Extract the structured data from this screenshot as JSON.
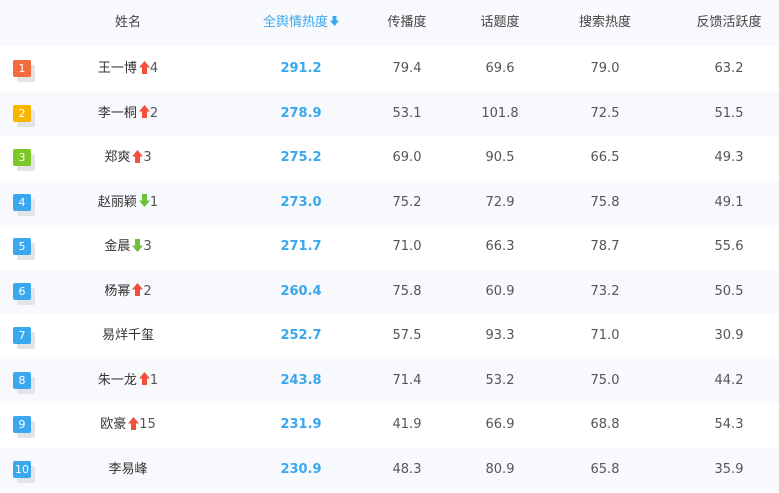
{
  "colors": {
    "accent": "#3aa8ee",
    "up": "#f0503c",
    "down": "#6cc03c",
    "rank_1": "#f26a3d",
    "rank_2": "#f8b600",
    "rank_3": "#7dc726",
    "rank_other": "#3aa8ee"
  },
  "columns": {
    "name": "姓名",
    "total": "全舆情热度",
    "spread": "传播度",
    "topic": "话题度",
    "search": "搜索热度",
    "feedback": "反馈活跃度"
  },
  "sort_icon": "arrow-down-icon",
  "rows": [
    {
      "rank": "1",
      "name": "王一博",
      "trend": "up",
      "trend_value": "4",
      "total": "291.2",
      "spread": "79.4",
      "topic": "69.6",
      "search": "79.0",
      "feedback": "63.2"
    },
    {
      "rank": "2",
      "name": "李一桐",
      "trend": "up",
      "trend_value": "2",
      "total": "278.9",
      "spread": "53.1",
      "topic": "101.8",
      "search": "72.5",
      "feedback": "51.5"
    },
    {
      "rank": "3",
      "name": "郑爽",
      "trend": "up",
      "trend_value": "3",
      "total": "275.2",
      "spread": "69.0",
      "topic": "90.5",
      "search": "66.5",
      "feedback": "49.3"
    },
    {
      "rank": "4",
      "name": "赵丽颖",
      "trend": "down",
      "trend_value": "1",
      "total": "273.0",
      "spread": "75.2",
      "topic": "72.9",
      "search": "75.8",
      "feedback": "49.1"
    },
    {
      "rank": "5",
      "name": "金晨",
      "trend": "down",
      "trend_value": "3",
      "total": "271.7",
      "spread": "71.0",
      "topic": "66.3",
      "search": "78.7",
      "feedback": "55.6"
    },
    {
      "rank": "6",
      "name": "杨幂",
      "trend": "up",
      "trend_value": "2",
      "total": "260.4",
      "spread": "75.8",
      "topic": "60.9",
      "search": "73.2",
      "feedback": "50.5"
    },
    {
      "rank": "7",
      "name": "易烊千玺",
      "trend": "none",
      "trend_value": "",
      "total": "252.7",
      "spread": "57.5",
      "topic": "93.3",
      "search": "71.0",
      "feedback": "30.9"
    },
    {
      "rank": "8",
      "name": "朱一龙",
      "trend": "up",
      "trend_value": "1",
      "total": "243.8",
      "spread": "71.4",
      "topic": "53.2",
      "search": "75.0",
      "feedback": "44.2"
    },
    {
      "rank": "9",
      "name": "欧豪",
      "trend": "up",
      "trend_value": "15",
      "total": "231.9",
      "spread": "41.9",
      "topic": "66.9",
      "search": "68.8",
      "feedback": "54.3"
    },
    {
      "rank": "10",
      "name": "李易峰",
      "trend": "none",
      "trend_value": "",
      "total": "230.9",
      "spread": "48.3",
      "topic": "80.9",
      "search": "65.8",
      "feedback": "35.9"
    }
  ]
}
